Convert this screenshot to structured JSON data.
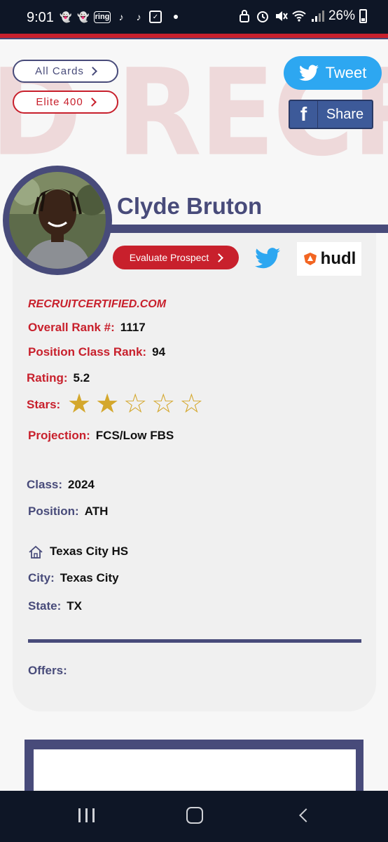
{
  "status": {
    "time": "9:01",
    "app_ring": "ring",
    "battery": "26%"
  },
  "background": {
    "watermark": "D RECRUI"
  },
  "nav": {
    "all_cards": "All Cards",
    "elite": "Elite 400"
  },
  "social": {
    "tweet": "Tweet",
    "share": "Share",
    "fb_glyph": "f"
  },
  "player": {
    "name": "Clyde Bruton",
    "evaluate": "Evaluate Prospect",
    "site": "RECRUITCERTIFIED.COM",
    "overall_rank_label": "Overall Rank #:",
    "overall_rank": "1117",
    "position_rank_label": "Position Class Rank:",
    "position_rank": "94",
    "rating_label": "Rating:",
    "rating": "5.2",
    "stars_label": "Stars:",
    "stars_filled": 2,
    "stars_total": 5,
    "projection_label": "Projection:",
    "projection": "FCS/Low FBS",
    "class_label": "Class:",
    "class": "2024",
    "position_label": "Position:",
    "position": "ATH",
    "school": "Texas City HS",
    "city_label": "City:",
    "city": "Texas City",
    "state_label": "State:",
    "state": "TX",
    "offers_label": "Offers:"
  },
  "hudl": {
    "label": "hudl"
  },
  "colors": {
    "red": "#c8202c",
    "navy": "#484b7a",
    "gold": "#d4a72c",
    "twitter": "#2da7f1",
    "facebook": "#3d5a99"
  },
  "icons": [
    "snapchat-icon",
    "ring-icon",
    "tiktok-icon",
    "twitter-icon",
    "facebook-icon",
    "hudl-icon",
    "house-icon",
    "star-icon"
  ]
}
